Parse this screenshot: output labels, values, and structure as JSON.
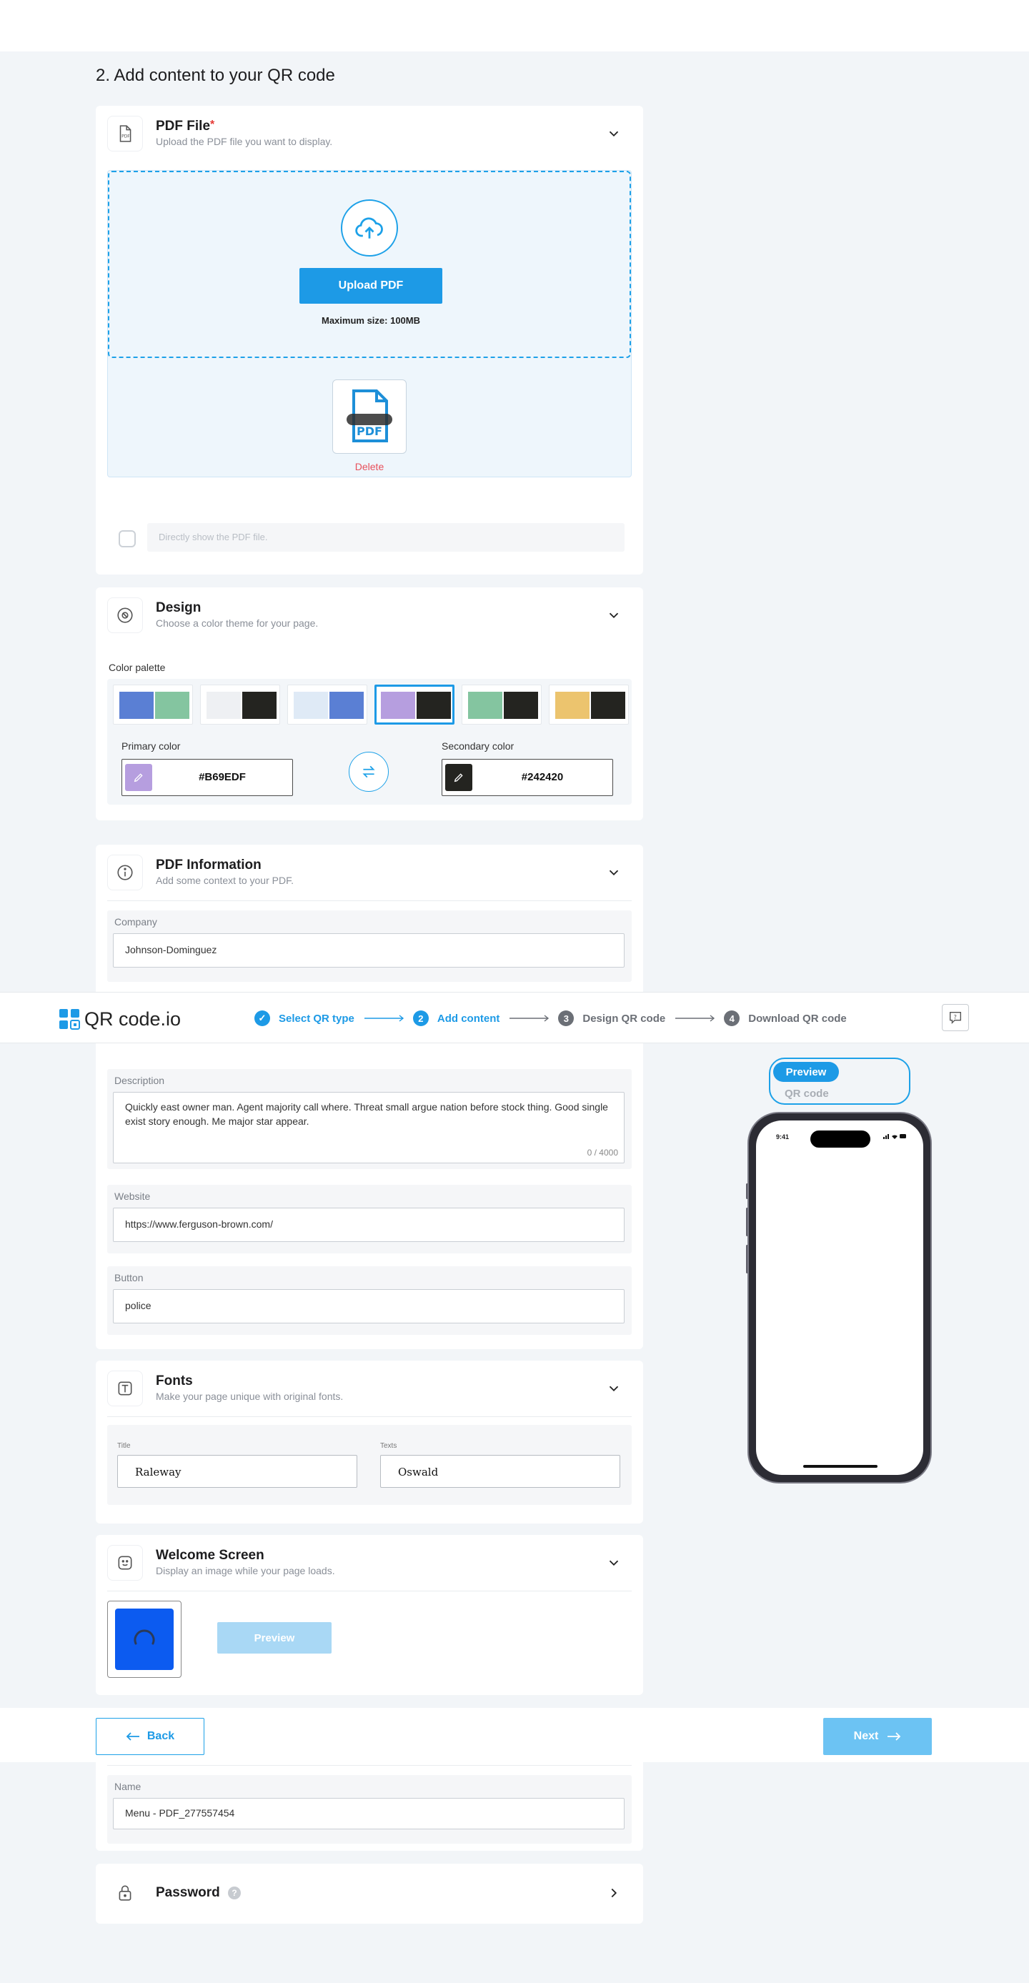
{
  "step_heading": "2. Add content to your QR code",
  "pdf_card": {
    "title": "PDF File",
    "required_mark": "*",
    "subtitle": "Upload the PDF file you want to display.",
    "upload_label": "Upload PDF",
    "max_size": "Maximum size: 100MB",
    "delete_label": "Delete",
    "direct_show_label": "Directly show the PDF file."
  },
  "design_card": {
    "title": "Design",
    "subtitle": "Choose a color theme for your page.",
    "palette_label": "Color palette",
    "palettes": [
      {
        "primary": "#5a7fd4",
        "secondary": "#84c5a0"
      },
      {
        "primary": "#eef0f3",
        "secondary": "#242420"
      },
      {
        "primary": "#dfeaf6",
        "secondary": "#5a7fd4"
      },
      {
        "primary": "#B69EDF",
        "secondary": "#242420"
      },
      {
        "primary": "#84c5a0",
        "secondary": "#242420"
      },
      {
        "primary": "#ecc46e",
        "secondary": "#242420"
      }
    ],
    "selected_palette": 3,
    "primary_label": "Primary color",
    "primary_value": "#B69EDF",
    "secondary_label": "Secondary color",
    "secondary_value": "#242420"
  },
  "info_card": {
    "title": "PDF Information",
    "subtitle": "Add some context to your PDF.",
    "company_label": "Company",
    "company_value": "Johnson-Dominguez",
    "description_label": "Description",
    "description_value": "Quickly east owner man. Agent majority call where. Threat small argue nation before stock thing. Good single exist story enough. Me major star appear.",
    "description_counter": "0 / 4000",
    "website_label": "Website",
    "website_value": "https://www.ferguson-brown.com/",
    "button_label": "Button",
    "button_value": "police"
  },
  "fonts_card": {
    "title": "Fonts",
    "subtitle": "Make your page unique with original fonts.",
    "title_label": "Title",
    "title_value": "Raleway",
    "texts_label": "Texts",
    "texts_value": "Oswald"
  },
  "welcome_card": {
    "title": "Welcome Screen",
    "subtitle": "Display an image while your page loads.",
    "preview_label": "Preview"
  },
  "name_card": {
    "name_label": "Name",
    "name_value": "Menu - PDF_277557454"
  },
  "password_card": {
    "title": "Password",
    "help_glyph": "?"
  },
  "navbar": {
    "logo_text": "QR code.io",
    "steps": [
      {
        "num": "✓",
        "label": "Select QR type",
        "state": "done"
      },
      {
        "num": "2",
        "label": "Add content",
        "state": "active"
      },
      {
        "num": "3",
        "label": "Design QR code",
        "state": "todo"
      },
      {
        "num": "4",
        "label": "Download QR code",
        "state": "todo"
      }
    ],
    "help_glyph": "?"
  },
  "preview": {
    "active_tab": "Preview",
    "inactive_tab": "QR code",
    "phone_time": "9:41"
  },
  "footer": {
    "back_label": "Back",
    "next_label": "Next"
  },
  "colors": {
    "accent": "#1d9ae6",
    "danger": "#e8505b",
    "muted_step": "#6b6f76"
  }
}
